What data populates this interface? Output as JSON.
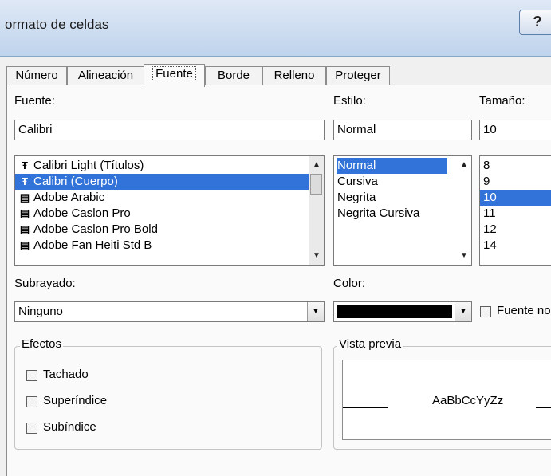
{
  "window": {
    "title": "ormato de celdas",
    "help_label": "?"
  },
  "tabs": [
    "Número",
    "Alineación",
    "Fuente",
    "Borde",
    "Relleno",
    "Proteger"
  ],
  "font": {
    "label": "Fuente:",
    "value": "Calibri",
    "items": [
      {
        "icon": "Ŧ",
        "label": "Calibri Light (Títulos)",
        "selected": false
      },
      {
        "icon": "Ŧ",
        "label": "Calibri (Cuerpo)",
        "selected": true
      },
      {
        "icon": "▤",
        "label": "Adobe Arabic",
        "selected": false
      },
      {
        "icon": "▤",
        "label": "Adobe Caslon Pro",
        "selected": false
      },
      {
        "icon": "▤",
        "label": "Adobe Caslon Pro Bold",
        "selected": false
      },
      {
        "icon": "▤",
        "label": "Adobe Fan Heiti Std B",
        "selected": false
      }
    ]
  },
  "style": {
    "label": "Estilo:",
    "value": "Normal",
    "items": [
      "Normal",
      "Cursiva",
      "Negrita",
      "Negrita Cursiva"
    ],
    "selected_index": 0
  },
  "size": {
    "label": "Tamaño:",
    "value": "10",
    "items": [
      "8",
      "9",
      "10",
      "11",
      "12",
      "14"
    ],
    "selected_index": 2
  },
  "underline": {
    "label": "Subrayado:",
    "value": "Ninguno"
  },
  "color": {
    "label": "Color:",
    "value_hex": "#000000"
  },
  "normal_font": {
    "label": "Fuente no"
  },
  "effects": {
    "label": "Efectos",
    "strikethrough": "Tachado",
    "superscript": "Superíndice",
    "subscript": "Subíndice"
  },
  "preview": {
    "label": "Vista previa",
    "sample": "AaBbCcYyZz"
  },
  "colors": {
    "selection": "#3173d8",
    "title_gradient_top": "#dfe9f6"
  }
}
